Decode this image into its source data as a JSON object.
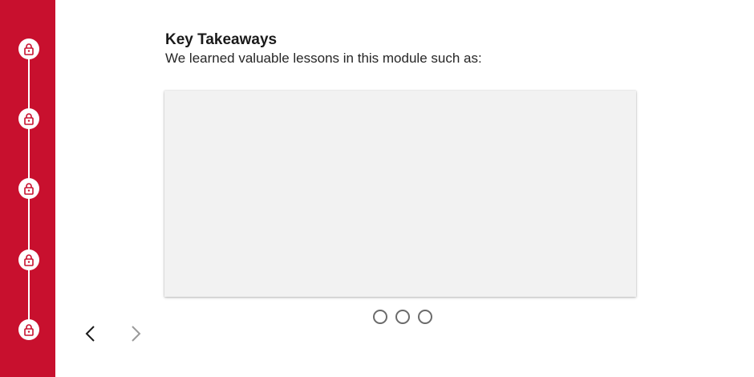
{
  "colors": {
    "brand": "#c8102e",
    "lock_node": "#ffffff",
    "card_bg": "#f2f2f2",
    "prev_arrow": "#1a1a1a",
    "next_arrow": "#9a9a9a"
  },
  "sidebar": {
    "nodes": [
      {
        "icon": "lock-icon",
        "state": "locked"
      },
      {
        "icon": "lock-icon",
        "state": "locked"
      },
      {
        "icon": "lock-icon",
        "state": "locked"
      },
      {
        "icon": "lock-icon",
        "state": "locked"
      },
      {
        "icon": "lock-icon",
        "state": "locked"
      }
    ]
  },
  "main": {
    "heading": "Key Takeaways",
    "subtitle": "We learned valuable lessons in this module such as:"
  },
  "carousel": {
    "dots": 3
  },
  "navigation": {
    "prev_icon": "chevron-left-icon",
    "next_icon": "chevron-right-icon"
  }
}
